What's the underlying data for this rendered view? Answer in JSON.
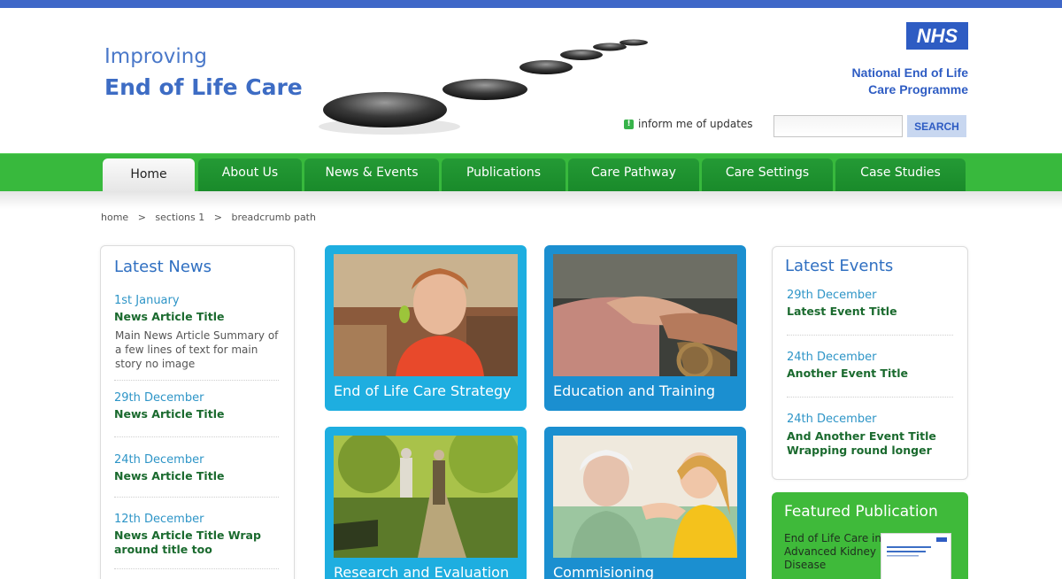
{
  "header": {
    "logo_line1": "Improving",
    "logo_line2": "End of Life Care",
    "nhs_logo": "NHS",
    "programme_line1": "National End of Life",
    "programme_line2": "Care Programme",
    "inform_text": "inform me of updates",
    "search_placeholder": "",
    "search_button": "SEARCH"
  },
  "nav": {
    "tabs": [
      {
        "label": "Home"
      },
      {
        "label": "About Us"
      },
      {
        "label": "News & Events"
      },
      {
        "label": "Publications"
      },
      {
        "label": "Care Pathway"
      },
      {
        "label": "Care Settings"
      },
      {
        "label": "Case Studies"
      }
    ]
  },
  "breadcrumb": {
    "items": [
      "home",
      "sections 1",
      "breadcrumb path"
    ],
    "separator": ">"
  },
  "latest_news": {
    "title": "Latest News",
    "items": [
      {
        "date": "1st January",
        "title": "News Article Title",
        "summary": "Main News Article Summary of a few lines of text for main story no image"
      },
      {
        "date": "29th December",
        "title": "News Article Title"
      },
      {
        "date": "24th December",
        "title": "News Article Title"
      },
      {
        "date": "12th December",
        "title_line1": "News Article Title Wrap",
        "title_line2": "around title too"
      }
    ]
  },
  "tiles": [
    {
      "label": "End of Life Care Strategy"
    },
    {
      "label": "Education and Training"
    },
    {
      "label": "Research and Evaluation"
    },
    {
      "label": "Commisioning"
    }
  ],
  "latest_events": {
    "title": "Latest Events",
    "items": [
      {
        "date": "29th December",
        "title": "Latest Event Title"
      },
      {
        "date": "24th December",
        "title": "Another Event Title"
      },
      {
        "date": "24th December",
        "title_line1": "And Another Event Title",
        "title_line2": "Wrapping round longer"
      }
    ]
  },
  "featured": {
    "title": "Featured Publication",
    "text": "End of Life Care in Advanced Kidney Disease"
  },
  "colors": {
    "brand_blue": "#3f67c8",
    "nav_green": "#38b93d",
    "tile_light_blue": "#1eaee0",
    "tile_dark_blue": "#1b8fd0",
    "news_title_green": "#1a6a2e"
  }
}
